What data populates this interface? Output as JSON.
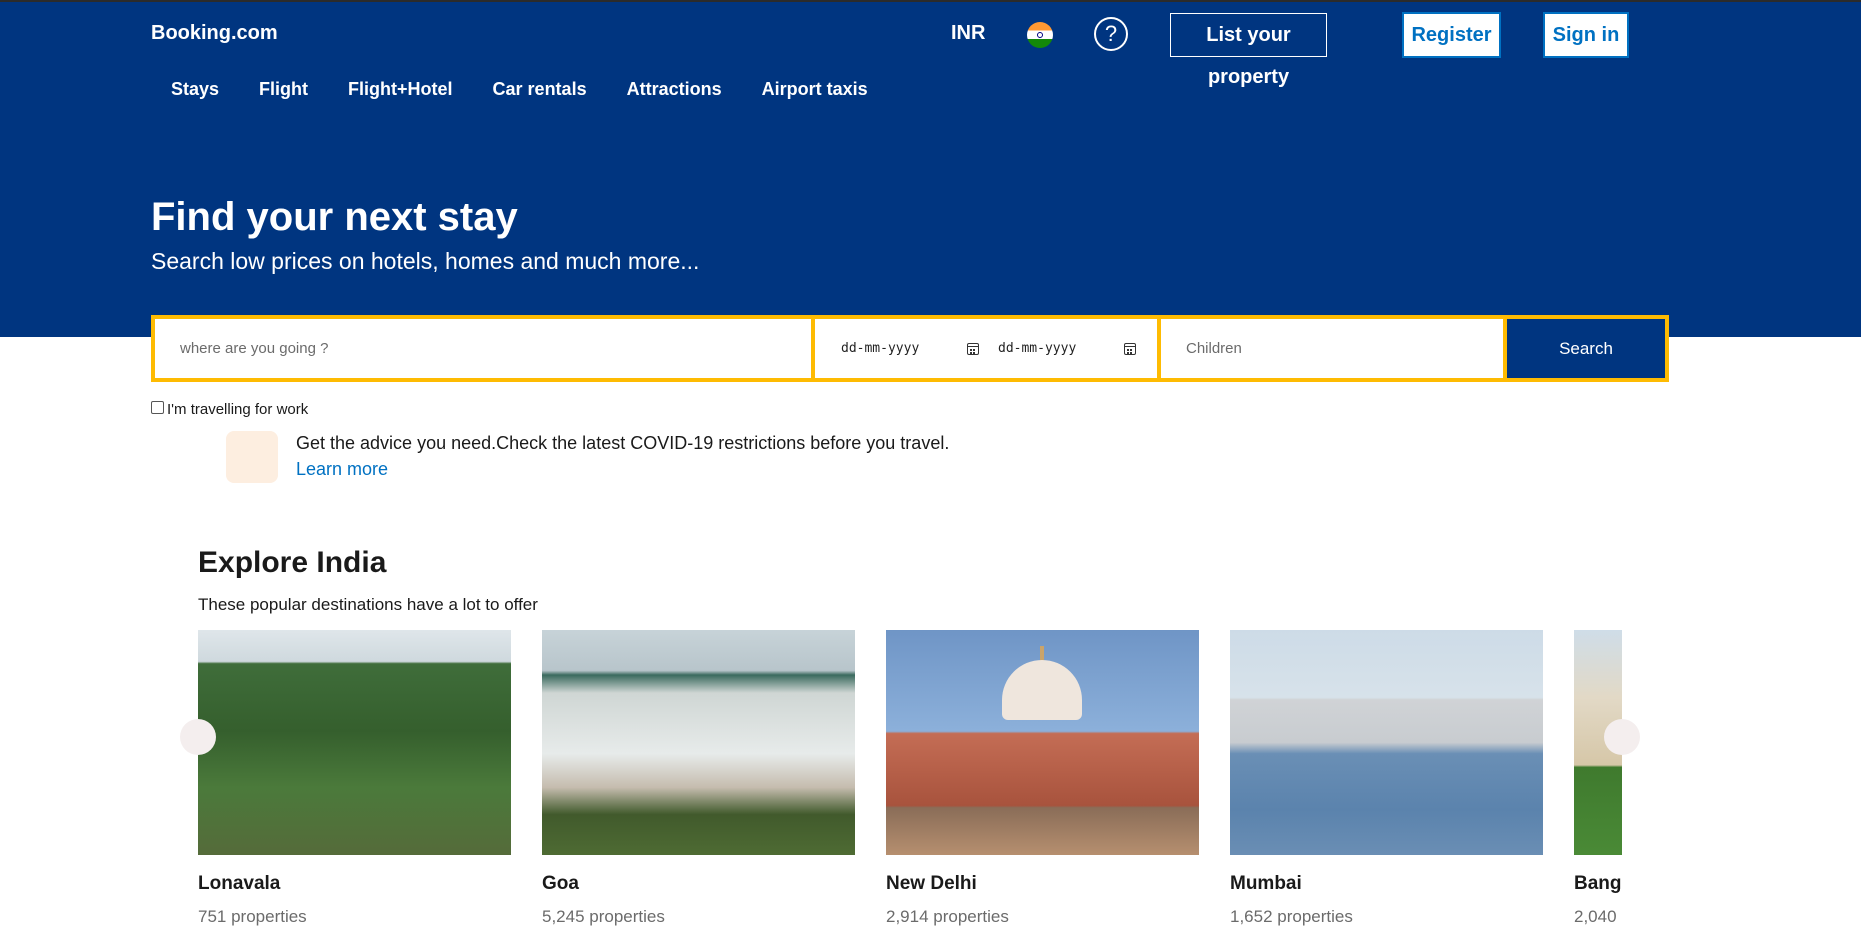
{
  "header": {
    "logo": "Booking.com",
    "currency": "INR",
    "help_glyph": "?",
    "list_property": "List your property",
    "register": "Register",
    "sign_in": "Sign in"
  },
  "nav": {
    "items": [
      {
        "label": "Stays"
      },
      {
        "label": "Flight"
      },
      {
        "label": "Flight+Hotel"
      },
      {
        "label": "Car rentals"
      },
      {
        "label": "Attractions"
      },
      {
        "label": "Airport taxis"
      }
    ]
  },
  "hero": {
    "title": "Find your next stay",
    "subtitle": "Search low prices on hotels, homes and much more..."
  },
  "search": {
    "destination_placeholder": "where are you going ?",
    "checkin_placeholder": "dd-mm-yyyy",
    "checkout_placeholder": "dd-mm-yyyy",
    "children_placeholder": "Children",
    "button": "Search",
    "work_checkbox": "I'm travelling for work",
    "work_checked": false
  },
  "notice": {
    "text": "Get the advice you need.Check the latest COVID-19 restrictions before you travel.",
    "link": "Learn more"
  },
  "explore": {
    "title": "Explore India",
    "subtitle": "These popular destinations have a lot to offer",
    "destinations": [
      {
        "name": "Lonavala",
        "properties": "751 properties",
        "image": "lonavala-hills"
      },
      {
        "name": "Goa",
        "properties": "5,245 properties",
        "image": "goa-beach"
      },
      {
        "name": "New Delhi",
        "properties": "2,914 properties",
        "image": "humayun-tomb"
      },
      {
        "name": "Mumbai",
        "properties": "1,652 properties",
        "image": "mumbai-skyline"
      },
      {
        "name": "Bang",
        "properties": "2,040",
        "image": "bangalore-palace"
      }
    ]
  },
  "colors": {
    "brand_blue": "#003580",
    "search_border": "#febb02",
    "link_blue": "#0071c2"
  }
}
